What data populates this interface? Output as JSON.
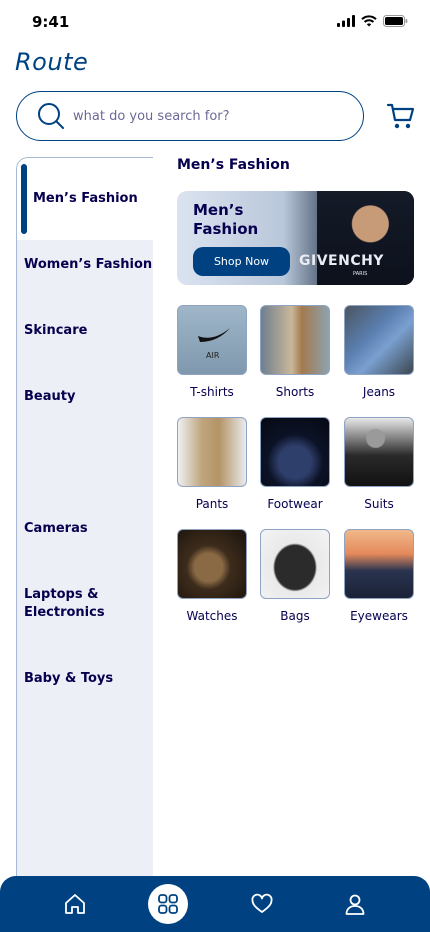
{
  "status": {
    "time": "9:41"
  },
  "brand": {
    "logo": "Route"
  },
  "search": {
    "placeholder": "what do you search for?"
  },
  "sidebar": {
    "items": [
      {
        "label": "Men’s Fashion",
        "active": true
      },
      {
        "label": "Women’s Fashion"
      },
      {
        "label": "Skincare"
      },
      {
        "label": "Beauty"
      },
      {
        "label": "Cameras"
      },
      {
        "label": "Laptops & Electronics"
      },
      {
        "label": "Baby & Toys"
      }
    ]
  },
  "main": {
    "section_title": "Men’s Fashion",
    "banner": {
      "title": "Men’s Fashion",
      "button": "Shop Now",
      "shirt_text": "GIVENCHY",
      "shirt_sub": "PARIS"
    },
    "categories": [
      {
        "label": "T-shirts"
      },
      {
        "label": "Shorts"
      },
      {
        "label": "Jeans"
      },
      {
        "label": "Pants"
      },
      {
        "label": "Footwear"
      },
      {
        "label": "Suits"
      },
      {
        "label": "Watches"
      },
      {
        "label": "Bags"
      },
      {
        "label": "Eyewears"
      }
    ]
  },
  "bottom_nav": {
    "items": [
      {
        "icon": "home-icon"
      },
      {
        "icon": "categories-icon",
        "active": true
      },
      {
        "icon": "heart-icon"
      },
      {
        "icon": "profile-icon"
      }
    ]
  },
  "colors": {
    "primary": "#004182",
    "text": "#06004f",
    "sidebar_bg": "#eceff5"
  }
}
